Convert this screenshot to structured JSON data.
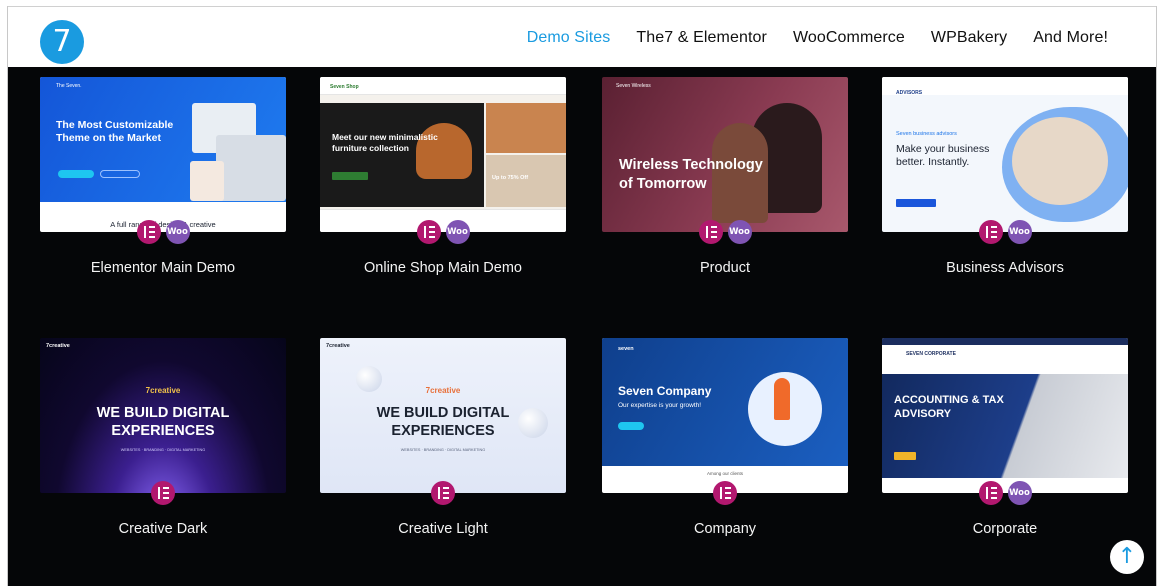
{
  "logo": {
    "text": "7"
  },
  "nav": [
    {
      "label": "Demo Sites",
      "active": true
    },
    {
      "label": "The7 & Elementor",
      "active": false
    },
    {
      "label": "WooCommerce",
      "active": false
    },
    {
      "label": "WPBakery",
      "active": false
    },
    {
      "label": "And More!",
      "active": false
    }
  ],
  "colors": {
    "accent": "#1a9be0",
    "elementor": "#b2186f",
    "woocommerce": "#7f54b3",
    "background": "#050608"
  },
  "demos": [
    {
      "title": "Elementor Main Demo",
      "badges": [
        "elementor",
        "woo"
      ],
      "thumb": {
        "brand": "The Seven.",
        "headline1": "The Most Customizable",
        "headline2": "Theme on the Market",
        "footer": "A full range of design & creative"
      }
    },
    {
      "title": "Online Shop Main Demo",
      "badges": [
        "elementor",
        "woo"
      ],
      "thumb": {
        "brand": "Seven Shop",
        "headline1": "Meet our new minimalistic",
        "headline2": "furniture collection",
        "side": "Up to 75% Off"
      }
    },
    {
      "title": "Product",
      "badges": [
        "elementor",
        "woo"
      ],
      "thumb": {
        "brand": "Seven Wireless",
        "headline1": "Wireless Technology",
        "headline2": "of Tomorrow"
      }
    },
    {
      "title": "Business Advisors",
      "badges": [
        "elementor",
        "woo"
      ],
      "thumb": {
        "brand": "ADVISORS",
        "kicker": "Seven business advisors",
        "headline1": "Make your business",
        "headline2": "better. Instantly."
      }
    },
    {
      "title": "Creative Dark",
      "badges": [
        "elementor"
      ],
      "thumb": {
        "brand": "7creative",
        "logo": "7creative",
        "headline1": "WE BUILD DIGITAL",
        "headline2": "EXPERIENCES",
        "tagline": "WEBSITES · BRANDING · DIGITAL MARKETING"
      }
    },
    {
      "title": "Creative Light",
      "badges": [
        "elementor"
      ],
      "thumb": {
        "brand": "7creative",
        "logo": "7creative",
        "headline1": "WE BUILD DIGITAL",
        "headline2": "EXPERIENCES",
        "tagline": "WEBSITES · BRANDING · DIGITAL MARKETING"
      }
    },
    {
      "title": "Company",
      "badges": [
        "elementor"
      ],
      "thumb": {
        "brand": "seven",
        "headline1": "Seven Company",
        "headline2": "Our expertise is your growth!",
        "footer": "Among our clients"
      }
    },
    {
      "title": "Corporate",
      "badges": [
        "elementor",
        "woo"
      ],
      "thumb": {
        "brand": "SEVEN CORPORATE",
        "headline1": "ACCOUNTING & TAX",
        "headline2": "ADVISORY"
      }
    }
  ],
  "badge_labels": {
    "woo": "Woo"
  },
  "scroll_top": {
    "icon": "arrow-up-icon"
  }
}
